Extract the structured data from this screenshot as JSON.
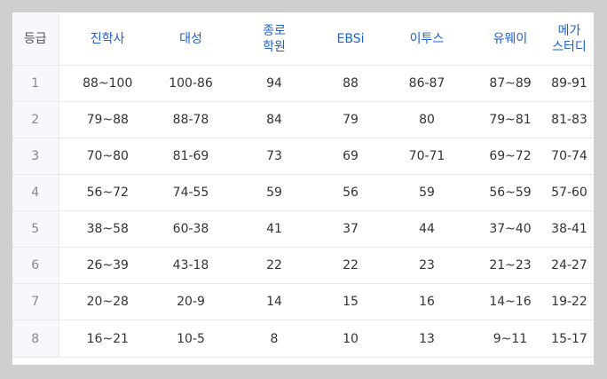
{
  "table": {
    "grade_header": "등급",
    "columns": [
      {
        "id": "jinhaksa",
        "lines": [
          "진학사"
        ]
      },
      {
        "id": "daesung",
        "lines": [
          "대성"
        ]
      },
      {
        "id": "jongro",
        "lines": [
          "종로",
          "학원"
        ]
      },
      {
        "id": "ebsi",
        "lines": [
          "EBSi"
        ]
      },
      {
        "id": "etoos",
        "lines": [
          "이투스"
        ]
      },
      {
        "id": "uway",
        "lines": [
          "유웨이"
        ]
      },
      {
        "id": "megastudy",
        "lines": [
          "메가",
          "스터디"
        ]
      }
    ],
    "rows": [
      {
        "grade": "1",
        "cells": [
          "88~100",
          "100-86",
          "94",
          "88",
          "86-87",
          "87~89",
          "89-91"
        ]
      },
      {
        "grade": "2",
        "cells": [
          "79~88",
          "88-78",
          "84",
          "79",
          "80",
          "79~81",
          "81-83"
        ]
      },
      {
        "grade": "3",
        "cells": [
          "70~80",
          "81-69",
          "73",
          "69",
          "70-71",
          "69~72",
          "70-74"
        ]
      },
      {
        "grade": "4",
        "cells": [
          "56~72",
          "74-55",
          "59",
          "56",
          "59",
          "56~59",
          "57-60"
        ]
      },
      {
        "grade": "5",
        "cells": [
          "38~58",
          "60-38",
          "41",
          "37",
          "44",
          "37~40",
          "38-41"
        ]
      },
      {
        "grade": "6",
        "cells": [
          "26~39",
          "43-18",
          "22",
          "22",
          "23",
          "21~23",
          "24-27"
        ]
      },
      {
        "grade": "7",
        "cells": [
          "20~28",
          "20-9",
          "14",
          "15",
          "16",
          "14~16",
          "19-22"
        ]
      },
      {
        "grade": "8",
        "cells": [
          "16~21",
          "10-5",
          "8",
          "10",
          "13",
          "9~11",
          "15-17"
        ]
      }
    ]
  },
  "colors": {
    "header_text": "#1e5fd0",
    "grade_column_bg": "#f7f8fb",
    "page_bg": "#cfcfcf"
  }
}
